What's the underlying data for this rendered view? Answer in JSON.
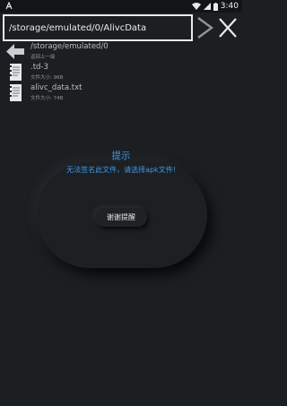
{
  "status_bar": {
    "time": "3:40"
  },
  "path_input": {
    "value": "/storage/emulated/0/AlivcData"
  },
  "file_list": [
    {
      "name": "/storage/emulated/0",
      "sub": "返回上一级",
      "icon": "back-arrow-icon"
    },
    {
      "name": ".td-3",
      "sub": "文件大小: 96B",
      "icon": "document-icon"
    },
    {
      "name": "alivc_data.txt",
      "sub": "文件大小: 74B",
      "icon": "document-icon"
    }
  ],
  "dialog": {
    "title": "提示",
    "message": "无法签名此文件，请选择apk文件!",
    "button_label": "谢谢提醒"
  },
  "colors": {
    "accent": "#3f97e8",
    "background": "#1c1f22"
  }
}
